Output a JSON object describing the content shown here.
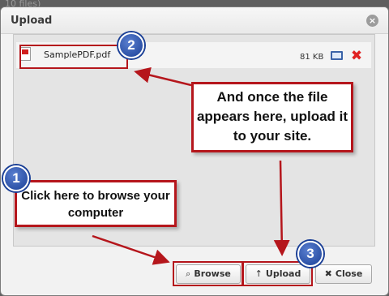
{
  "background": {
    "text": "10 files)"
  },
  "dialog": {
    "title": "Upload"
  },
  "file": {
    "name": "SamplePDF.pdf",
    "size": "81 KB"
  },
  "buttons": {
    "browse": {
      "label": "Browse",
      "icon": "⌕"
    },
    "upload": {
      "label": "Upload",
      "icon": "↑"
    },
    "close": {
      "label": "Close",
      "icon": "✖"
    }
  },
  "callouts": {
    "step1": "Click here to browse your computer",
    "step2": "And once the file appears here, upload it to your site."
  },
  "badges": {
    "b1": "1",
    "b2": "2",
    "b3": "3"
  },
  "colors": {
    "highlight": "#b5161c",
    "badge": "#1a3f96",
    "delete": "#e02222"
  }
}
